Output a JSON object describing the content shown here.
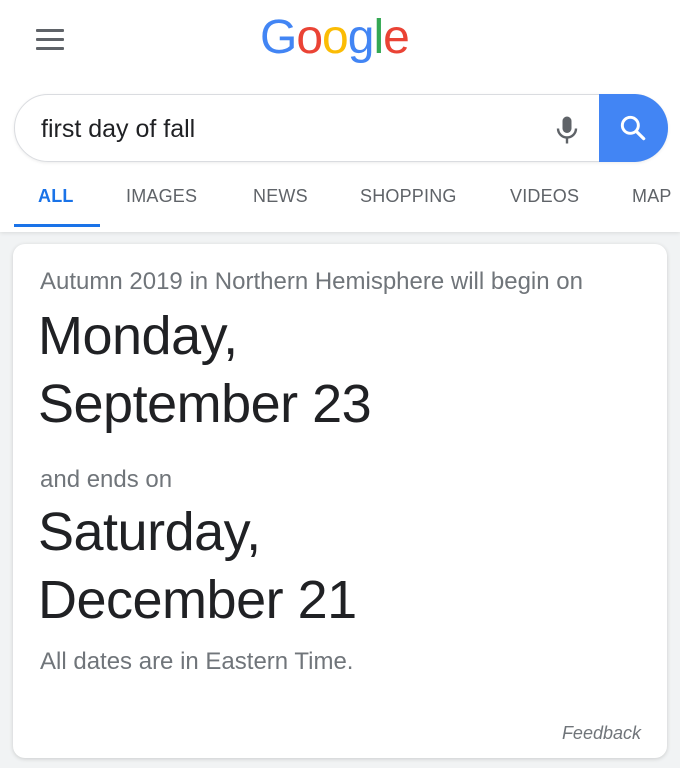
{
  "logo": {
    "letters": [
      {
        "char": "G",
        "color": "#4285f4"
      },
      {
        "char": "o",
        "color": "#ea4335"
      },
      {
        "char": "o",
        "color": "#fbbc05"
      },
      {
        "char": "g",
        "color": "#4285f4"
      },
      {
        "char": "l",
        "color": "#34a853"
      },
      {
        "char": "e",
        "color": "#ea4335"
      }
    ]
  },
  "search": {
    "query": "first day of fall",
    "placeholder": ""
  },
  "icons": {
    "menu": "hamburger-menu-icon",
    "mic": "microphone-icon",
    "search": "magnifier-icon"
  },
  "colors": {
    "accent": "#1a73e8",
    "search_button": "#4285f4"
  },
  "tabs": [
    {
      "label": "ALL",
      "active": true
    },
    {
      "label": "IMAGES",
      "active": false
    },
    {
      "label": "NEWS",
      "active": false
    },
    {
      "label": "SHOPPING",
      "active": false
    },
    {
      "label": "VIDEOS",
      "active": false
    },
    {
      "label": "MAP",
      "active": false
    }
  ],
  "answer": {
    "lead": "Autumn 2019 in Northern Hemisphere will begin on",
    "start_day": "Monday,",
    "start_date": "September 23",
    "middle": "and ends on",
    "end_day": "Saturday,",
    "end_date": "December 21",
    "note": "All dates are in Eastern Time.",
    "feedback": "Feedback"
  }
}
